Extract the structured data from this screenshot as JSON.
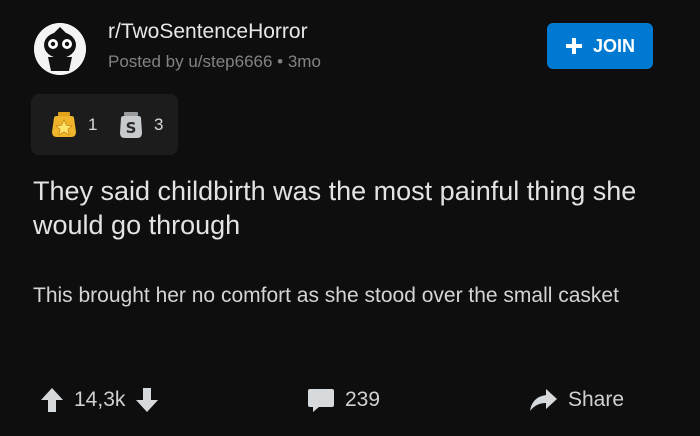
{
  "header": {
    "subreddit": "r/TwoSentenceHorror",
    "meta": "Posted by u/step6666 • 3mo",
    "join_label": "JOIN"
  },
  "awards": [
    {
      "icon": "gold-star-award-icon",
      "count": "1"
    },
    {
      "icon": "silver-award-icon",
      "count": "3"
    }
  ],
  "post": {
    "title": "They said childbirth was the most painful thing she would go through",
    "body": "This brought her no comfort as she stood over the small casket"
  },
  "footer": {
    "score": "14,3k",
    "comments": "239",
    "share_label": "Share"
  },
  "colors": {
    "background": "#0e0e0e",
    "join_button": "#0079d3",
    "muted_text": "#818384",
    "award_box": "#1c1c1d"
  }
}
